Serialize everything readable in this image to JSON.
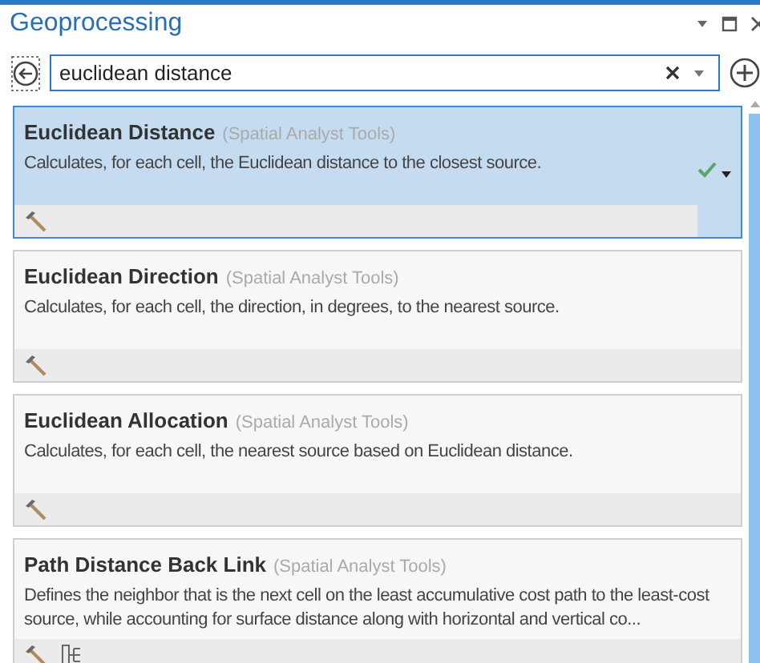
{
  "window": {
    "title": "Geoprocessing"
  },
  "search": {
    "value": "euclidean distance"
  },
  "results": [
    {
      "name": "Euclidean Distance",
      "category": "(Spatial Analyst Tools)",
      "description": "Calculates, for each cell, the Euclidean distance to the closest source.",
      "selected": true,
      "kind": "single"
    },
    {
      "name": "Euclidean Direction",
      "category": "(Spatial Analyst Tools)",
      "description": "Calculates, for each cell, the direction, in degrees, to the nearest source.",
      "selected": false,
      "kind": "single"
    },
    {
      "name": "Euclidean Allocation",
      "category": "(Spatial Analyst Tools)",
      "description": "Calculates, for each cell, the nearest source based on Euclidean distance.",
      "selected": false,
      "kind": "single"
    },
    {
      "name": "Path Distance Back Link",
      "category": "(Spatial Analyst Tools)",
      "description": "Defines the neighbor that is the next cell on the least accumulative cost path to the least-cost source, while accounting for surface distance along with horizontal and vertical co...",
      "selected": false,
      "kind": "double"
    }
  ]
}
